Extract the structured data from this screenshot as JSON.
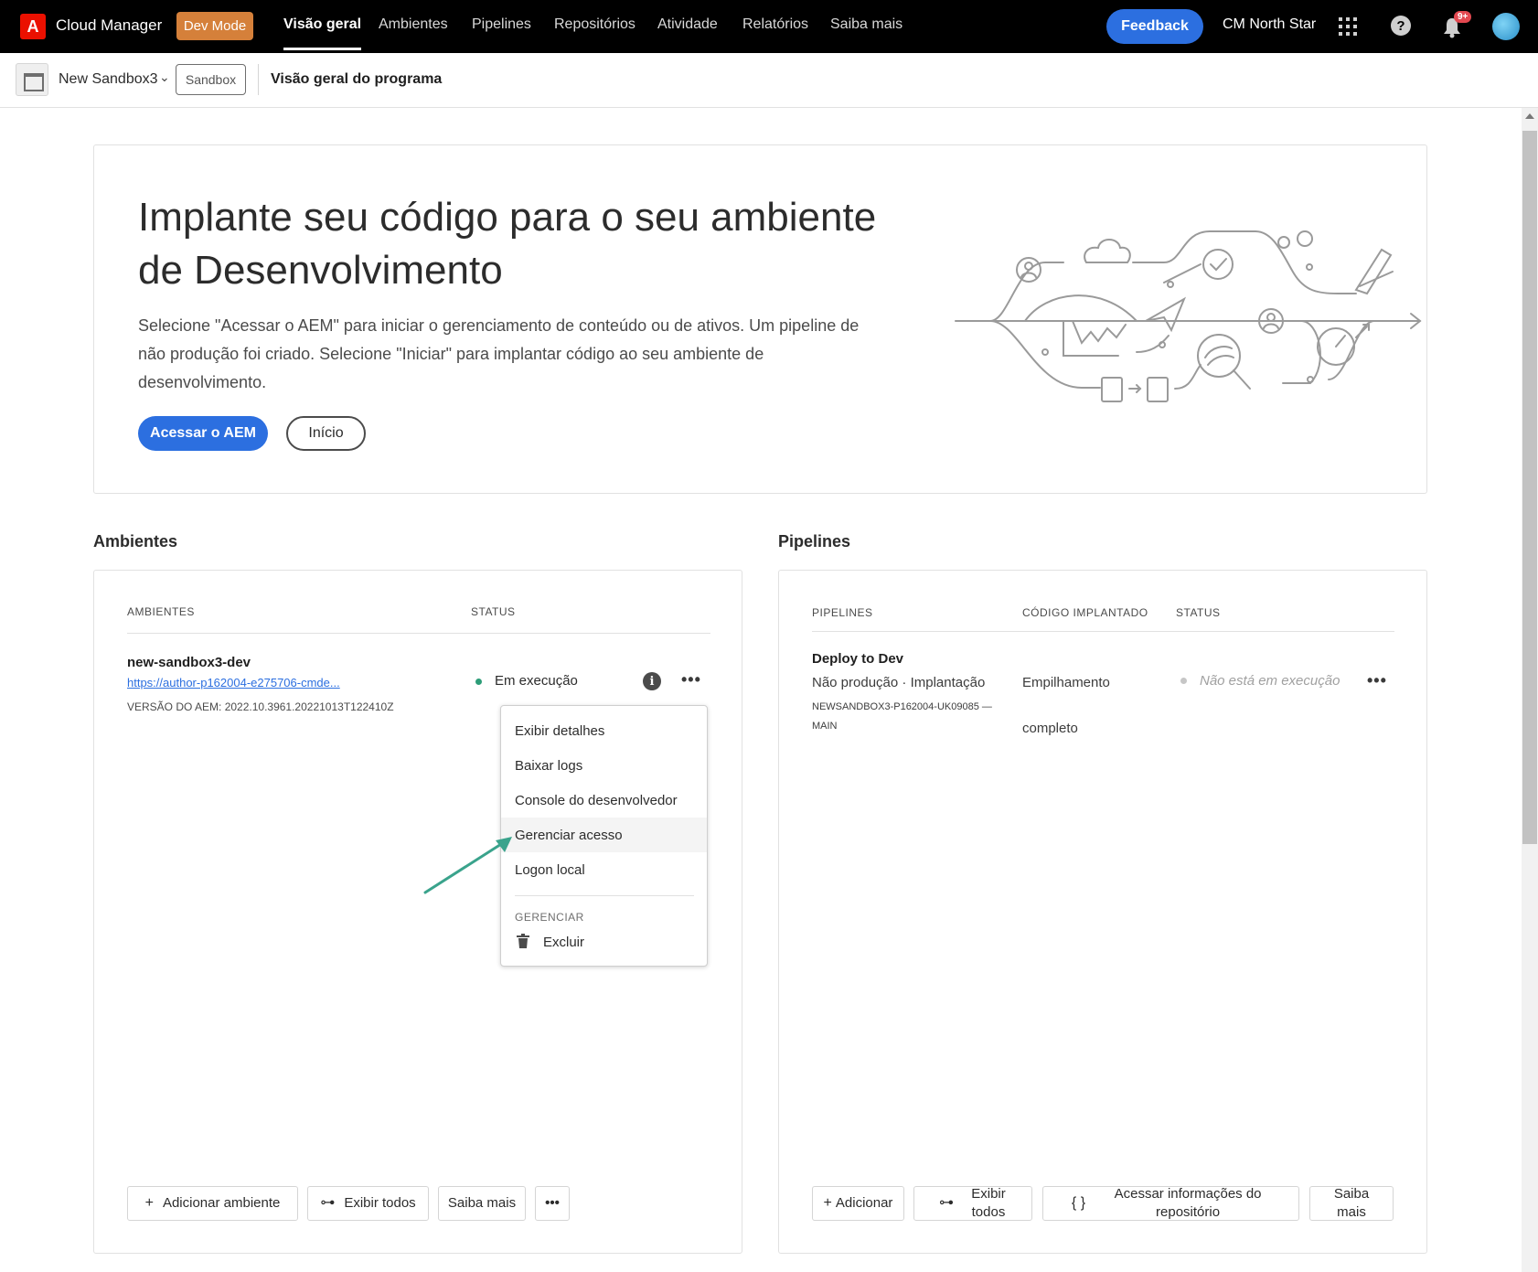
{
  "nav": {
    "logo_letter": "A",
    "app_name": "Cloud Manager",
    "dev_mode": "Dev Mode",
    "tabs": [
      "Visão geral",
      "Ambientes",
      "Pipelines",
      "Repositórios",
      "Atividade",
      "Relatórios",
      "Saiba mais"
    ],
    "feedback": "Feedback",
    "org_name": "CM North Star",
    "help_glyph": "?",
    "notification_badge": "9+"
  },
  "subheader": {
    "program_name": "New Sandbox3",
    "program_tag": "Sandbox",
    "page_title": "Visão geral do programa"
  },
  "hero": {
    "title": "Implante seu código para o seu ambiente de Desenvolvimento",
    "text": "Selecione \"Acessar o AEM\" para iniciar o gerenciamento de conteúdo ou de ativos. Um pipeline de não produção foi criado. Selecione \"Iniciar\" para implantar código ao seu ambiente de desenvolvimento.",
    "primary_button": "Acessar o AEM",
    "secondary_button": "Início"
  },
  "environments": {
    "section_title": "Ambientes",
    "col_env": "AMBIENTES",
    "col_status": "STATUS",
    "env_name": "new-sandbox3-dev",
    "env_link": "https://author-p162004-e275706-cmde...",
    "env_version": "VERSÃO DO AEM: 2022.10.3961.20221013T122410Z",
    "status": "Em execução",
    "status_color": "#2d9d78",
    "info_glyph": "i",
    "more_glyph": "•••",
    "menu": {
      "items": [
        "Exibir detalhes",
        "Baixar logs",
        "Console do desenvolvedor",
        "Gerenciar acesso",
        "Logon local"
      ],
      "section": "GERENCIAR",
      "delete": "Excluir"
    },
    "footer": {
      "add": "Adicionar ambiente",
      "view_all": "Exibir todos",
      "learn_more": "Saiba mais",
      "more": "•••"
    }
  },
  "pipelines": {
    "section_title": "Pipelines",
    "col_pipelines": "PIPELINES",
    "col_code": "CÓDIGO IMPLANTADO",
    "col_status": "STATUS",
    "pipeline_name": "Deploy to Dev",
    "pipeline_type": "Não produção · Implantação",
    "pipeline_repo": "NEWSANDBOX3-P162004-UK09085 —",
    "pipeline_branch": "MAIN",
    "code_line1": "Empilhamento",
    "code_line2": "completo",
    "status": "Não está em execução",
    "status_color": "#b3b3b3",
    "more_glyph": "•••",
    "footer": {
      "add": "Adicionar",
      "view_all": "Exibir todos",
      "repo_info": "Acessar informações do repositório",
      "learn_more": "Saiba mais",
      "repo_icon": "{ }"
    }
  },
  "colors": {
    "accent": "#2c6fe0",
    "dev_mode": "#d5803a",
    "annotation_arrow": "#3aa38c"
  }
}
